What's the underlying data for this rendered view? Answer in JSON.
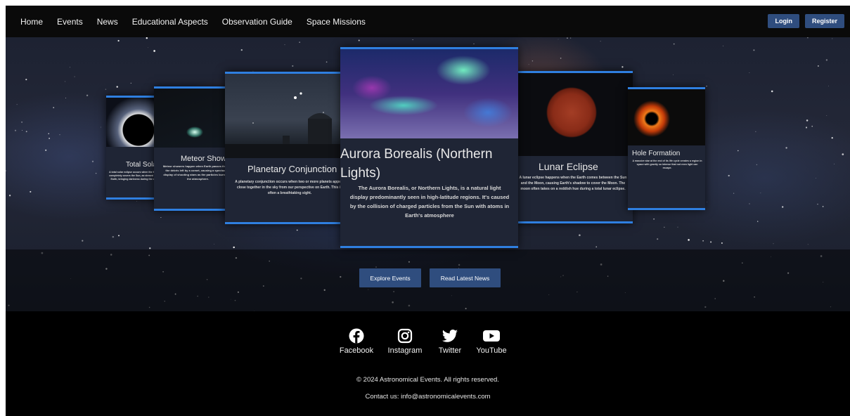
{
  "nav": {
    "links": [
      "Home",
      "Events",
      "News",
      "Educational Aspects",
      "Observation Guide",
      "Space Missions"
    ],
    "login_label": "Login",
    "register_label": "Register"
  },
  "carousel": {
    "cards": [
      {
        "title": "Total Sola",
        "description": "A total solar eclipse occurs when the Moon completely covers the Sun, as viewed from Earth, bringing darkness during the day."
      },
      {
        "title": "Meteor Show",
        "description": "Meteor showers happen when Earth passes through the debris left by a comet, causing a spectacular display of shooting stars as the particles burn up in the atmosphere."
      },
      {
        "title": "Planetary Conjunction",
        "description": "A planetary conjunction occurs when two or more planets appear close together in the sky from our perspective on Earth. This is often a breathtaking sight."
      },
      {
        "title": "Aurora Borealis (Northern Lights)",
        "description": "The Aurora Borealis, or Northern Lights, is a natural light display predominantly seen in high-latitude regions. It's caused by the collision of charged particles from the Sun with atoms in Earth's atmosphere"
      },
      {
        "title": "Lunar Eclipse",
        "description": "A lunar eclipse happens when the Earth comes between the Sun and the Moon, causing Earth's shadow to cover the Moon. The moon often takes on a reddish hue during a total lunar eclipse."
      },
      {
        "title": "Hole Formation",
        "description": "A massive star at the end of its life cycle creates a region in space with gravity so intense that not even light can escape."
      }
    ]
  },
  "hero": {
    "explore_label": "Explore Events",
    "news_label": "Read Latest News"
  },
  "footer": {
    "socials": [
      {
        "label": "Facebook",
        "icon": "facebook-icon"
      },
      {
        "label": "Instagram",
        "icon": "instagram-icon"
      },
      {
        "label": "Twitter",
        "icon": "twitter-icon"
      },
      {
        "label": "YouTube",
        "icon": "youtube-icon"
      }
    ],
    "copyright": "© 2024 Astronomical Events. All rights reserved.",
    "contact": "Contact us: info@astronomicalevents.com"
  },
  "colors": {
    "accent": "#2f7fe0",
    "button": "#2f4d7e",
    "card_bg": "#1f2535"
  }
}
